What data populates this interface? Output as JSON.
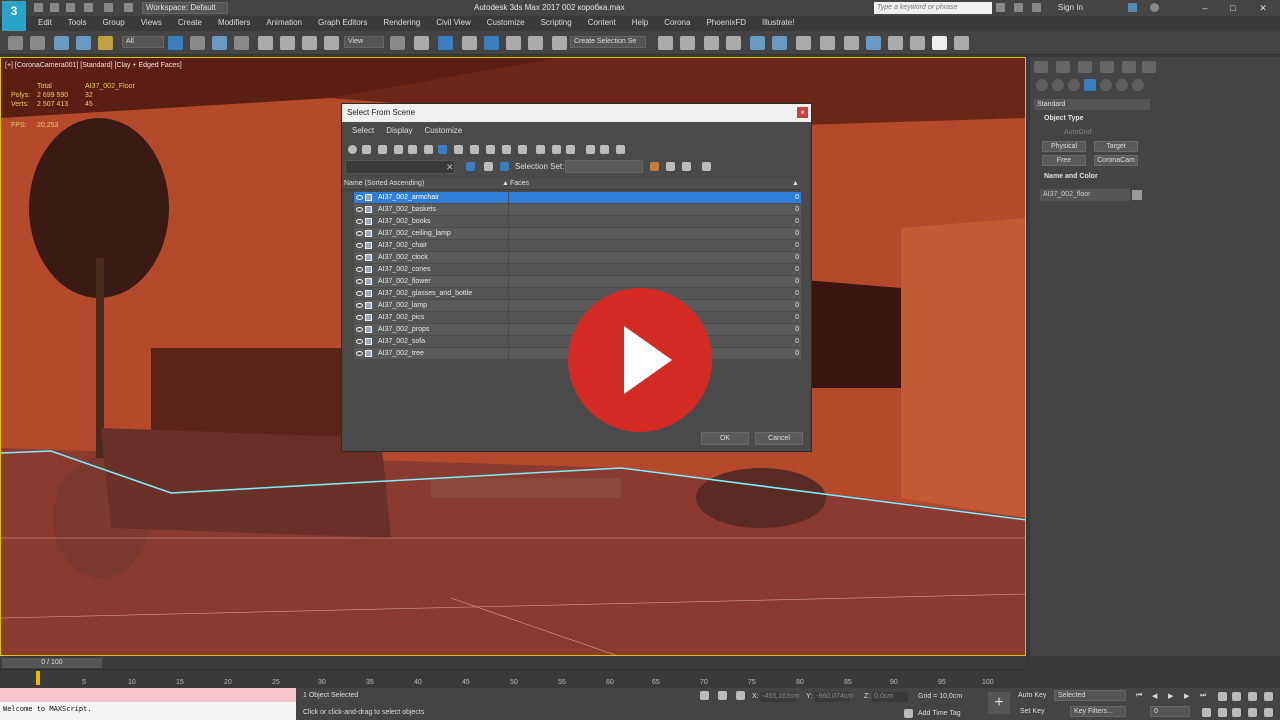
{
  "window": {
    "title": "Autodesk 3ds Max 2017     002 коробка.max",
    "workspace": "Workspace: Default",
    "search_placeholder": "Type a keyword or phrase",
    "sign_in": "Sign In"
  },
  "menu": [
    "Edit",
    "Tools",
    "Group",
    "Views",
    "Create",
    "Modifiers",
    "Animation",
    "Graph Editors",
    "Rendering",
    "Civil View",
    "Customize",
    "Scripting",
    "Content",
    "Help",
    "Corona",
    "PhoenixFD",
    "Illustrate!"
  ],
  "toolbar": {
    "filter_value": "All",
    "view_value": "View",
    "create_selection_set": "Create Selection Se"
  },
  "viewport": {
    "label": "[+] [CoronaCamera001] [Standard] [Clay + Edged Faces]",
    "stats_total": "Total",
    "stats_object": "AI37_002_Floor",
    "polys_label": "Polys:",
    "polys_total": "2 699 590",
    "polys_obj": "32",
    "verts_label": "Verts:",
    "verts_total": "2 507 413",
    "verts_obj": "45",
    "fps_label": "FPS:",
    "fps_value": "20,253"
  },
  "command_panel": {
    "dropdown": "Standard",
    "object_type": "Object Type",
    "autogrid": "AutoGrid",
    "buttons": [
      "Physical",
      "Target",
      "Free",
      "CoronaCam"
    ],
    "name_and_color": "Name and Color",
    "object_name": "AI37_002_floor"
  },
  "dialog": {
    "title": "Select From Scene",
    "menus": [
      "Select",
      "Display",
      "Customize"
    ],
    "selection_set_label": "Selection Set:",
    "col_name": "Name (Sorted Ascending)",
    "col_faces": "Faces",
    "rows": [
      {
        "name": "AI37_002_armchair",
        "faces": "0"
      },
      {
        "name": "AI37_002_baskets",
        "faces": "0"
      },
      {
        "name": "AI37_002_books",
        "faces": "0"
      },
      {
        "name": "AI37_002_ceiling_lamp",
        "faces": "0"
      },
      {
        "name": "AI37_002_chair",
        "faces": "0"
      },
      {
        "name": "AI37_002_clock",
        "faces": "0"
      },
      {
        "name": "AI37_002_cones",
        "faces": "0"
      },
      {
        "name": "AI37_002_flower",
        "faces": "0"
      },
      {
        "name": "AI37_002_glasses_and_bottle",
        "faces": "0"
      },
      {
        "name": "AI37_002_lamp",
        "faces": "0"
      },
      {
        "name": "AI37_002_pics",
        "faces": "0"
      },
      {
        "name": "AI37_002_props",
        "faces": "0"
      },
      {
        "name": "AI37_002_sofa",
        "faces": "0"
      },
      {
        "name": "AI37_002_tree",
        "faces": "0"
      }
    ],
    "ok": "OK",
    "cancel": "Cancel"
  },
  "timeline": {
    "frame": "0 / 100",
    "ticks": [
      "5",
      "10",
      "15",
      "20",
      "25",
      "30",
      "35",
      "40",
      "45",
      "50",
      "55",
      "60",
      "65",
      "70",
      "75",
      "80",
      "85",
      "90",
      "95",
      "100"
    ]
  },
  "status": {
    "maxscript": "Welcome to MAXScript.",
    "selected": "1 Object Selected",
    "hint": "Click or click-and-drag to select objects",
    "x_label": "X:",
    "x_value": "-455,163cm",
    "y_label": "Y:",
    "y_value": "-960,074cm",
    "z_label": "Z:",
    "z_value": "0,0cm",
    "grid": "Grid = 10,0cm",
    "add_time_tag": "Add Time Tag",
    "auto_key": "Auto Key",
    "set_key": "Set Key",
    "key_mode": "Selected",
    "key_filters": "Key Filters...",
    "frame_value": "0"
  },
  "colors": {
    "viewport_bg": "#b84a2a",
    "selection_blue": "#2f7ed8",
    "play_red": "#d42a24",
    "stats_yellow": "#e8d060"
  }
}
